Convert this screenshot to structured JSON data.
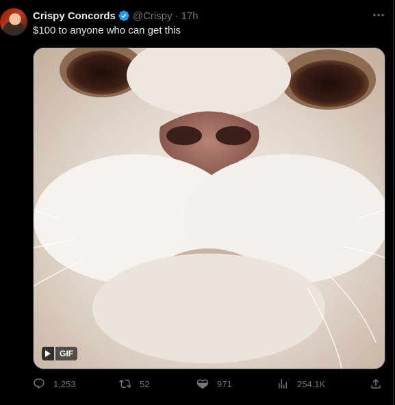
{
  "tweet": {
    "author": {
      "display_name": "Crispy Concords",
      "handle": "@Crispy",
      "verified": true
    },
    "separator": "·",
    "time": "17h",
    "text": "$100 to anyone who can get this",
    "media": {
      "type": "gif",
      "badge_label": "GIF",
      "subject": "close-up of a cat's face"
    },
    "actions": {
      "replies": "1,253",
      "retweets": "52",
      "likes": "971",
      "views": "254.1K"
    }
  },
  "colors": {
    "background": "#000000",
    "primary_text": "#e7e9ea",
    "secondary_text": "#71767b",
    "verified_blue": "#1d9bf0",
    "border": "#2f3336"
  },
  "icons": [
    "verified-icon",
    "more-icon",
    "play-icon",
    "reply-icon",
    "retweet-icon",
    "like-icon",
    "views-icon",
    "share-icon"
  ]
}
